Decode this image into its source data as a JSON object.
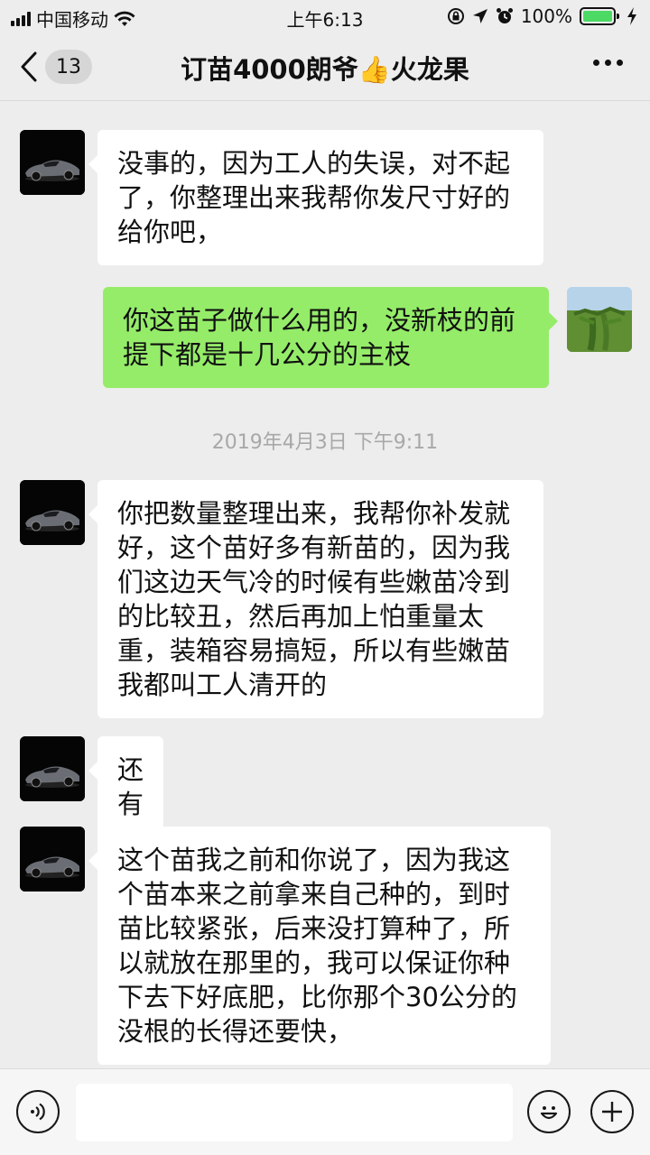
{
  "status_bar": {
    "carrier": "中国移动",
    "time": "上午6:13",
    "battery": "100%",
    "icons": [
      "signal-icon",
      "wifi-icon",
      "rotation-lock-icon",
      "location-icon",
      "alarm-icon",
      "battery-icon",
      "charging-icon"
    ]
  },
  "nav": {
    "back_count": "13",
    "title": "订苗4000朗爷👍火龙果",
    "more_icon": "more-icon"
  },
  "messages": [
    {
      "side": "left",
      "avatar": "car-avatar",
      "lines": [
        "没事的，因为工人的失误，对不起",
        "了，你整理出来我帮你发尺寸好的",
        "给你吧，"
      ]
    },
    {
      "side": "right",
      "avatar": "dragonfruit-avatar",
      "lines": [
        "你这苗子做什么用的，没新枝的前",
        "提下都是十几公分的主枝"
      ]
    },
    {
      "type": "timestamp",
      "text": "2019年4月3日 下午9:11"
    },
    {
      "side": "left",
      "avatar": "car-avatar",
      "lines": [
        "你把数量整理出来，我帮你补发就",
        "好，这个苗好多有新苗的，因为我",
        "们这边天气冷的时候有些嫩苗冷到",
        "的比较丑，然后再加上怕重量太",
        "重，装箱容易搞短，所以有些嫩苗",
        "我都叫工人清开的"
      ]
    },
    {
      "side": "left",
      "avatar": "car-avatar",
      "lines": [
        "还有"
      ]
    },
    {
      "side": "left",
      "avatar": "car-avatar",
      "lines": [
        "这个苗我之前和你说了，因为我这",
        "个苗本来之前拿来自己种的，到时",
        "苗比较紧张，后来没打算种了，所",
        "以就放在那里的，我可以保证你种",
        "下去下好底肥，比你那个30公分的",
        "没根的长得还要快，"
      ]
    }
  ],
  "input_bar": {
    "value": "",
    "icons": [
      "voice-icon",
      "emoji-icon",
      "plus-icon"
    ]
  },
  "colors": {
    "background": "#ededed",
    "bubble_received": "#ffffff",
    "bubble_sent": "#95ec69",
    "timestamp": "#a8a8a8",
    "battery": "#4cd964"
  }
}
